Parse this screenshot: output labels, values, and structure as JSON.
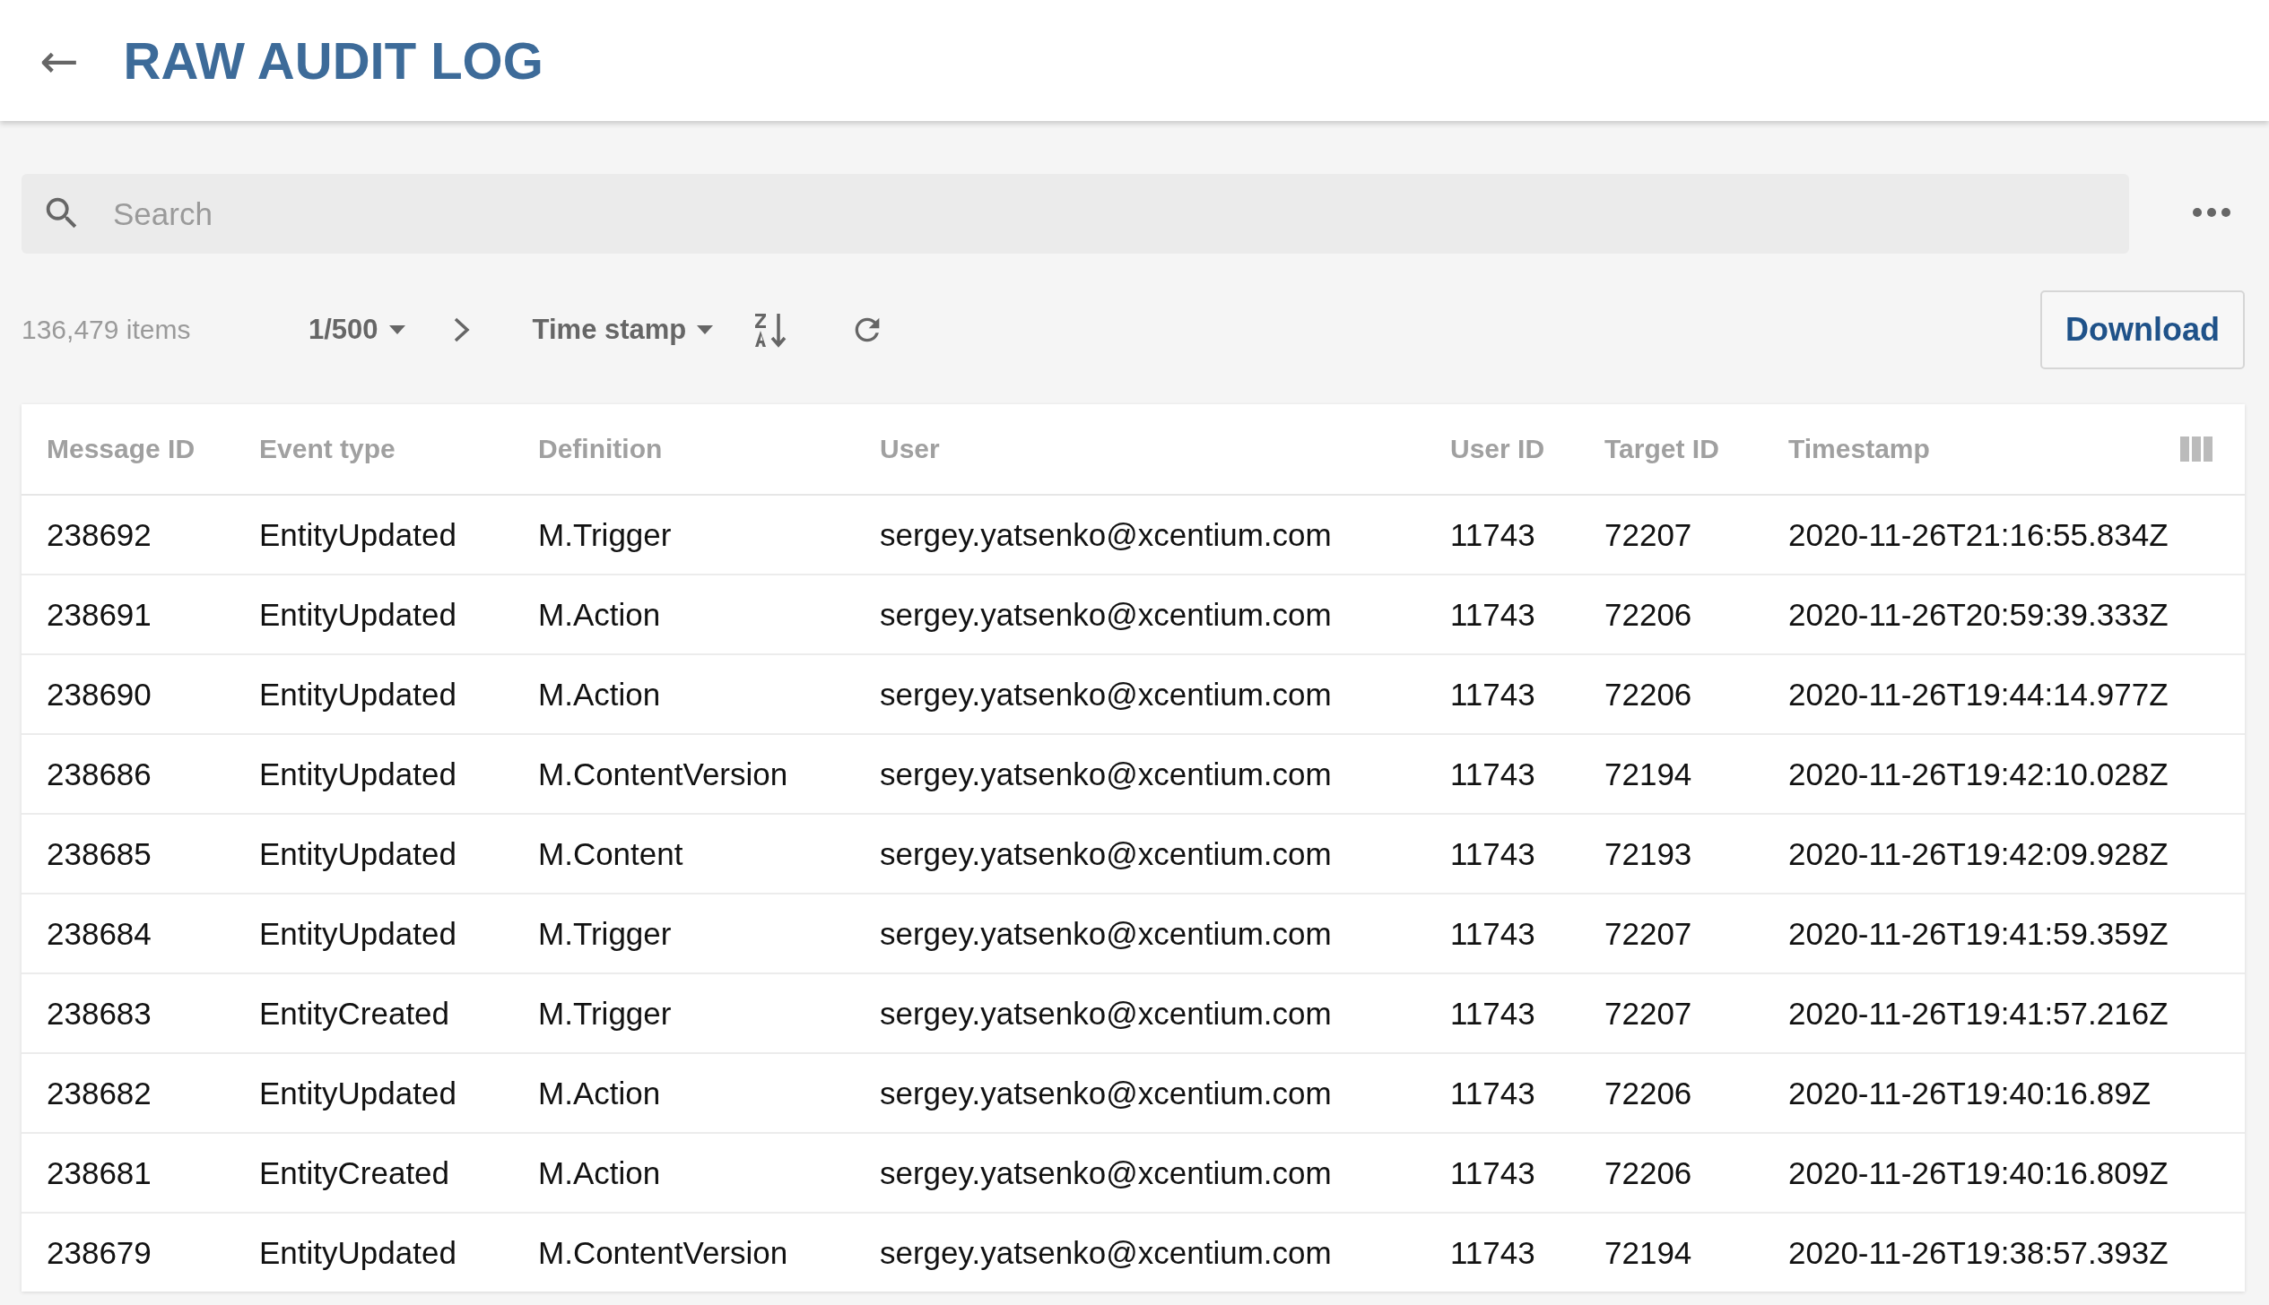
{
  "header": {
    "back_icon": "←",
    "title": "RAW AUDIT LOG"
  },
  "search": {
    "placeholder": "Search"
  },
  "toolbar": {
    "item_count": "136,479 items",
    "page": "1/500",
    "sort_field": "Time stamp",
    "download_button": "Download"
  },
  "table": {
    "columns": [
      "Message ID",
      "Event type",
      "Definition",
      "User",
      "User ID",
      "Target ID",
      "Timestamp"
    ],
    "rows": [
      [
        "238692",
        "EntityUpdated",
        "M.Trigger",
        "sergey.yatsenko@xcentium.com",
        "11743",
        "72207",
        "2020-11-26T21:16:55.834Z"
      ],
      [
        "238691",
        "EntityUpdated",
        "M.Action",
        "sergey.yatsenko@xcentium.com",
        "11743",
        "72206",
        "2020-11-26T20:59:39.333Z"
      ],
      [
        "238690",
        "EntityUpdated",
        "M.Action",
        "sergey.yatsenko@xcentium.com",
        "11743",
        "72206",
        "2020-11-26T19:44:14.977Z"
      ],
      [
        "238686",
        "EntityUpdated",
        "M.ContentVersion",
        "sergey.yatsenko@xcentium.com",
        "11743",
        "72194",
        "2020-11-26T19:42:10.028Z"
      ],
      [
        "238685",
        "EntityUpdated",
        "M.Content",
        "sergey.yatsenko@xcentium.com",
        "11743",
        "72193",
        "2020-11-26T19:42:09.928Z"
      ],
      [
        "238684",
        "EntityUpdated",
        "M.Trigger",
        "sergey.yatsenko@xcentium.com",
        "11743",
        "72207",
        "2020-11-26T19:41:59.359Z"
      ],
      [
        "238683",
        "EntityCreated",
        "M.Trigger",
        "sergey.yatsenko@xcentium.com",
        "11743",
        "72207",
        "2020-11-26T19:41:57.216Z"
      ],
      [
        "238682",
        "EntityUpdated",
        "M.Action",
        "sergey.yatsenko@xcentium.com",
        "11743",
        "72206",
        "2020-11-26T19:40:16.89Z"
      ],
      [
        "238681",
        "EntityCreated",
        "M.Action",
        "sergey.yatsenko@xcentium.com",
        "11743",
        "72206",
        "2020-11-26T19:40:16.809Z"
      ],
      [
        "238679",
        "EntityUpdated",
        "M.ContentVersion",
        "sergey.yatsenko@xcentium.com",
        "11743",
        "72194",
        "2020-11-26T19:38:57.393Z"
      ]
    ]
  }
}
